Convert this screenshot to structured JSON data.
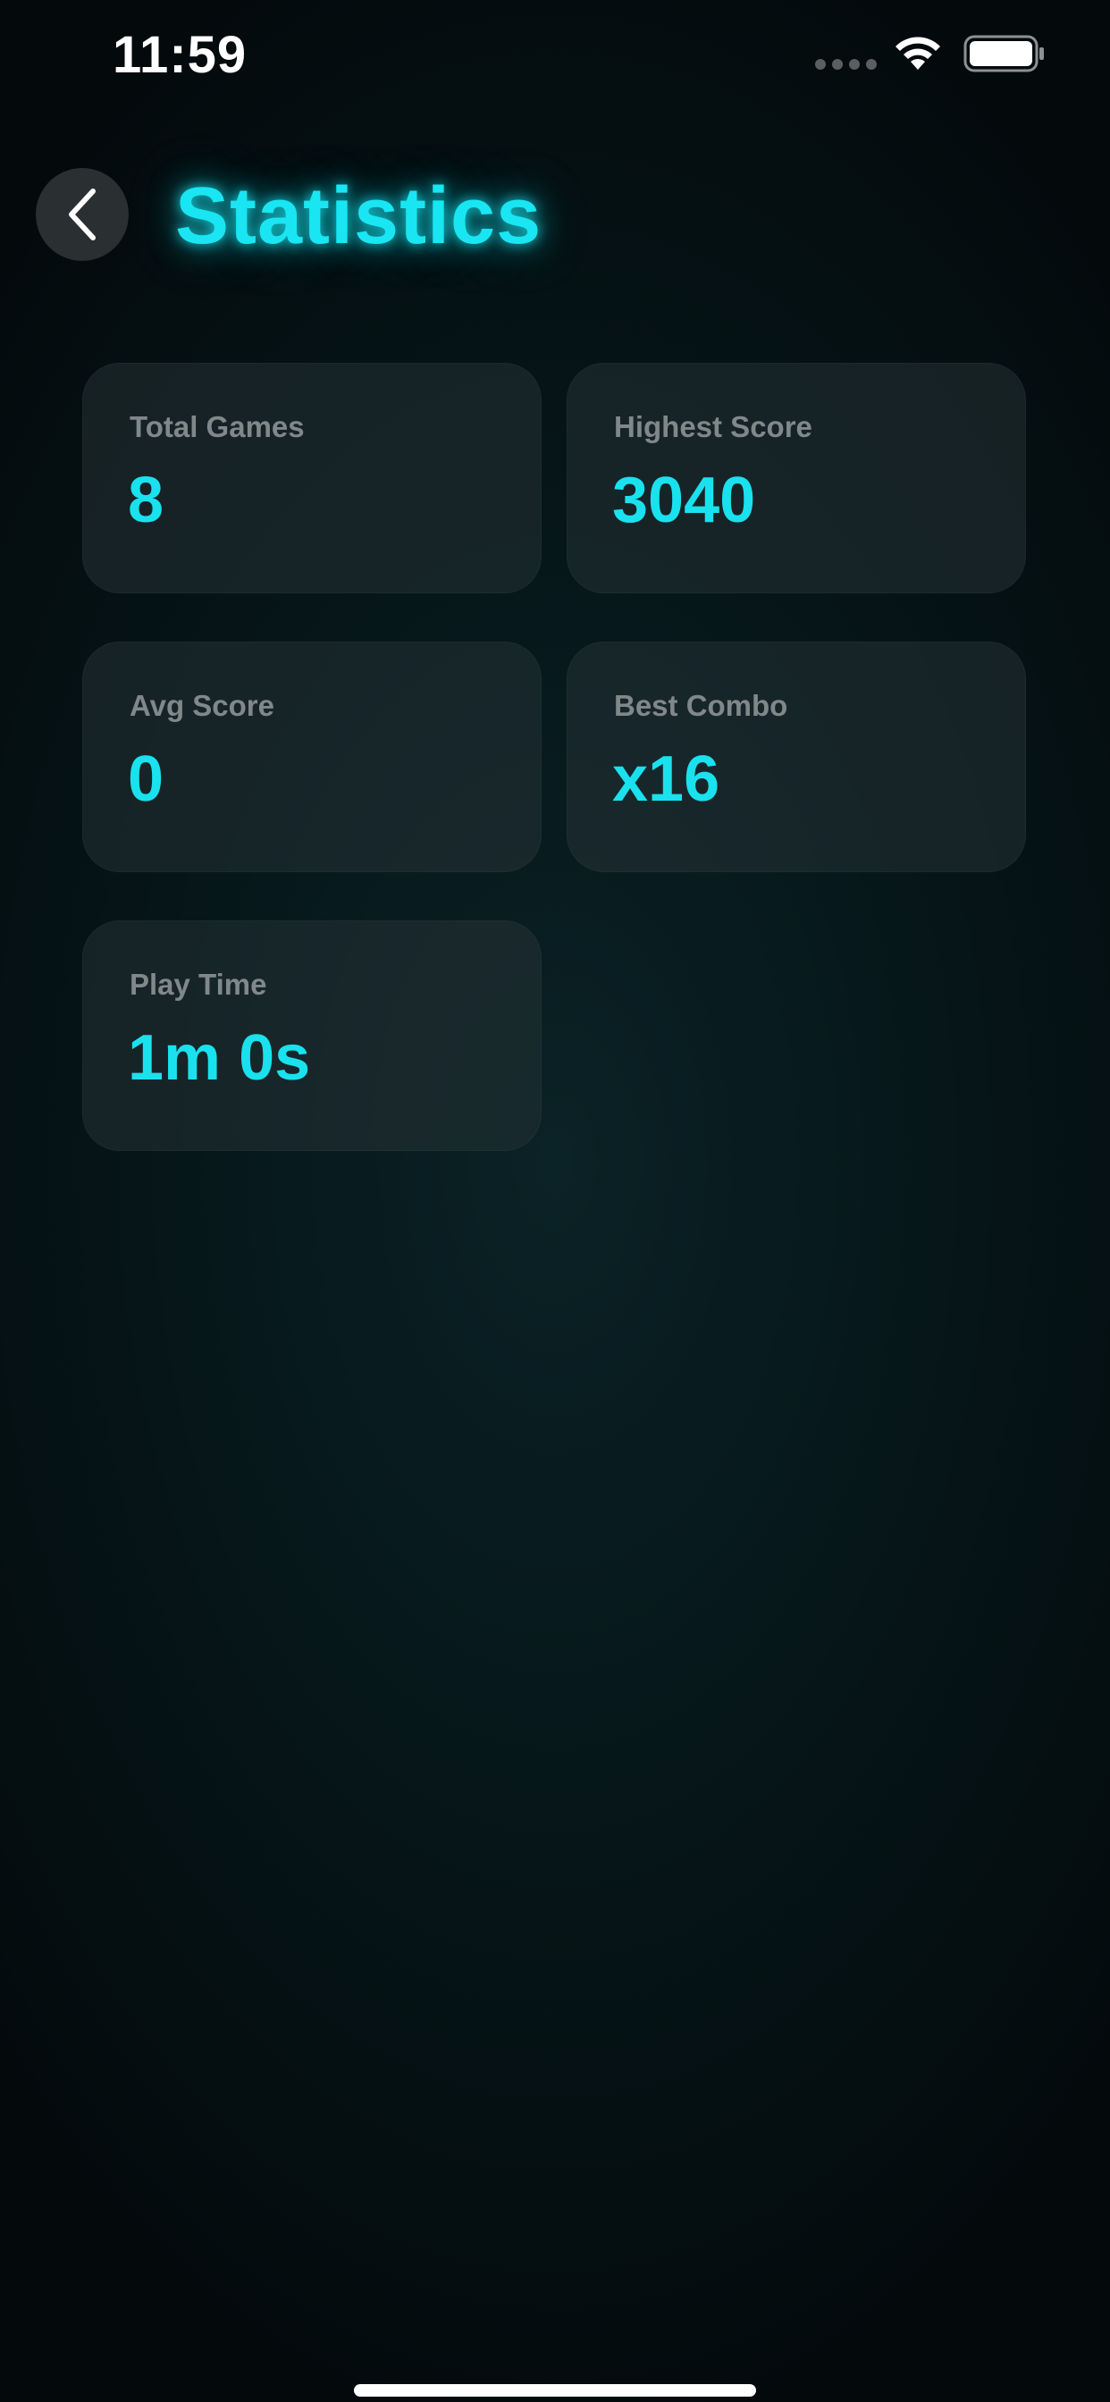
{
  "status_bar": {
    "time": "11:59"
  },
  "header": {
    "title": "Statistics",
    "back_icon": "chevron-left-icon"
  },
  "stats": {
    "total_games": {
      "label": "Total Games",
      "value": "8"
    },
    "highest_score": {
      "label": "Highest Score",
      "value": "3040"
    },
    "avg_score": {
      "label": "Avg Score",
      "value": "0"
    },
    "best_combo": {
      "label": "Best Combo",
      "value": "x16"
    },
    "play_time": {
      "label": "Play Time",
      "value": "1m 0s"
    }
  },
  "colors": {
    "accent": "#19E6F2",
    "label": "#80888A",
    "card_background": "#1A2628",
    "background": "#04090B"
  }
}
